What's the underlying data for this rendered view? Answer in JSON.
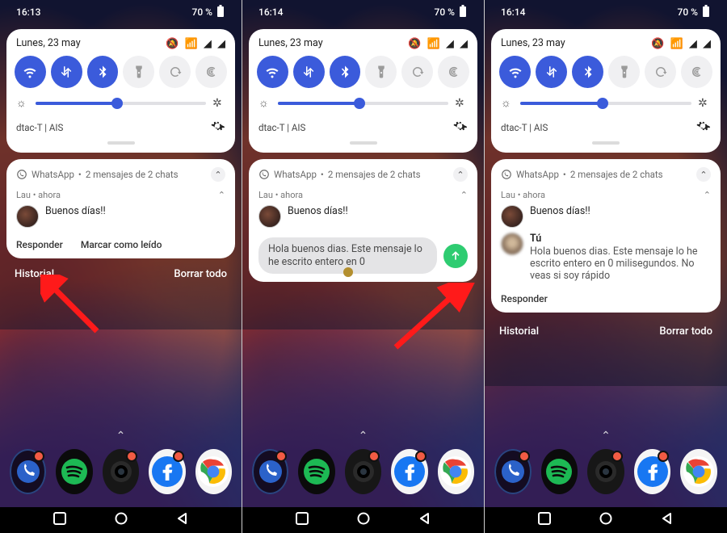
{
  "shared": {
    "battery_pct_label": "70 %",
    "date_label": "Lunes, 23 may",
    "carrier": "dtac-T | AIS",
    "brightness_pct": 48,
    "qs_tiles": [
      {
        "name": "wifi",
        "on": true
      },
      {
        "name": "data",
        "on": true
      },
      {
        "name": "bluetooth",
        "on": true
      },
      {
        "name": "flashlight",
        "on": false
      },
      {
        "name": "autorotate",
        "on": false
      },
      {
        "name": "hotspot",
        "on": false
      }
    ],
    "notification": {
      "app": "WhatsApp",
      "summary": "2 mensajes de 2 chats",
      "sender": "Lau",
      "time_rel": "ahora",
      "message": "Buenos días!!"
    },
    "dock_apps": [
      "phone-folder",
      "spotify",
      "camera",
      "facebook",
      "chrome"
    ]
  },
  "screens": [
    {
      "clock": "16:13",
      "actions": {
        "reply": "Responder",
        "mark_read": "Marcar como leído"
      },
      "footer": {
        "history": "Historial",
        "clear_all": "Borrar todo"
      },
      "arrow_target": "responder"
    },
    {
      "clock": "16:14",
      "reply_draft": "Hola buenos dias. Este mensaje lo he escrito entero en 0",
      "send_visible": true,
      "arrow_target": "send"
    },
    {
      "clock": "16:14",
      "own_reply": {
        "who": "Tú",
        "text": "Hola buenos dias. Este mensaje lo he escrito entero en 0 milisegundos. No veas si soy rápido"
      },
      "actions": {
        "reply": "Responder"
      },
      "footer": {
        "history": "Historial",
        "clear_all": "Borrar todo"
      }
    }
  ]
}
